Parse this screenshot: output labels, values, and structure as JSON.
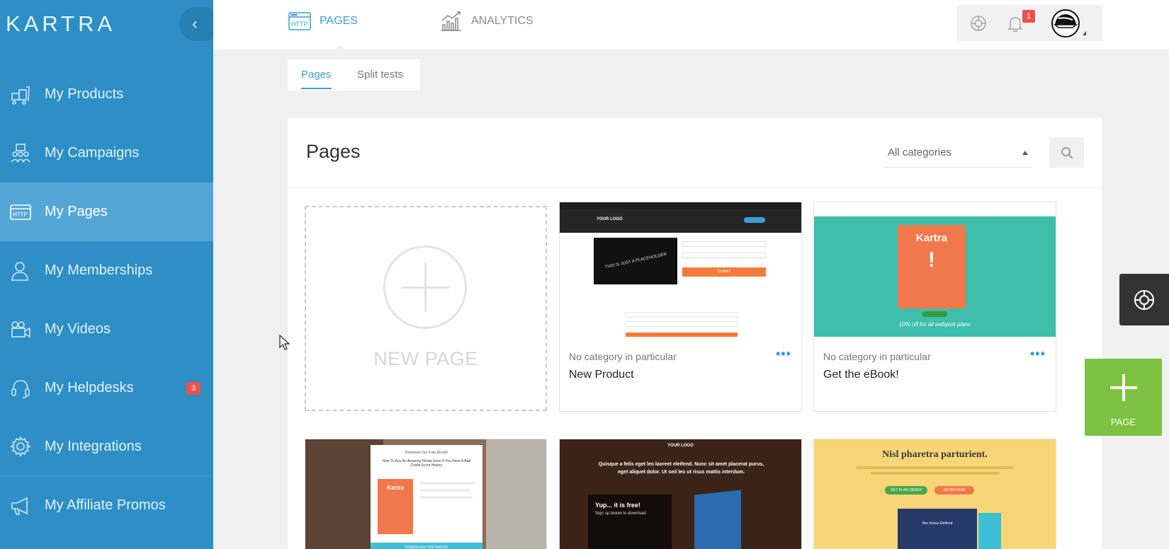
{
  "sidebar": {
    "brand": "KARTRA",
    "collapse_icon": "chevron-left-icon",
    "items": [
      {
        "label": "My Products",
        "icon": "products-icon"
      },
      {
        "label": "My Campaigns",
        "icon": "campaigns-icon"
      },
      {
        "label": "My Pages",
        "icon": "http-icon",
        "active": true
      },
      {
        "label": "My Memberships",
        "icon": "memberships-icon"
      },
      {
        "label": "My Videos",
        "icon": "video-camera-icon"
      },
      {
        "label": "My Helpdesks",
        "icon": "headset-icon",
        "badge": "3"
      },
      {
        "label": "My Integrations",
        "icon": "gear-icon"
      },
      {
        "label": "My Affiliate Promos",
        "icon": "megaphone-icon"
      }
    ]
  },
  "topbar": {
    "tabs": [
      {
        "label": "PAGES",
        "icon": "http-icon",
        "active": true
      },
      {
        "label": "ANALYTICS",
        "icon": "analytics-icon"
      }
    ],
    "notification_count": "1",
    "icons": [
      "help-icon",
      "bell-icon",
      "avatar"
    ]
  },
  "subtabs": {
    "pages": "Pages",
    "split_tests": "Split tests"
  },
  "panel": {
    "title": "Pages",
    "category_select": "All categories",
    "search_icon": "search-icon"
  },
  "new_page": {
    "label": "NEW PAGE"
  },
  "cards": [
    {
      "category": "No category in particular",
      "title": "New Product",
      "thumb": {
        "logo": "YOUR LOGO",
        "video_text": "THIS IS JUST A PLACEHOLDER",
        "button": "SUBMIT"
      }
    },
    {
      "category": "No category in particular",
      "title": "Get the eBook!",
      "thumb": {
        "book_title": "Kartra",
        "caption": "10% off for all webpick plans"
      }
    },
    {
      "thumb": {
        "heading": "Download Our Free Ebook!",
        "subheading": "How To Buy An Amazing House Even If You Have A Bad Credit Score History",
        "book_title": "Kartra",
        "button": "DOWNLOAD THE EBOOK"
      }
    },
    {
      "thumb": {
        "logo": "YOUR LOGO",
        "headline": "Quisque a felis eget leo laoreet eleifend. Nunc sit amet placerat purus, eget aliquet dolor. Ut sed leo ut risus mattis interdum.",
        "panel_title": "Yup... it is free!",
        "panel_sub": "Sign up below to download"
      }
    },
    {
      "thumb": {
        "headline": "Nisl pharetra parturient.",
        "button_a": "GET IN AN ORDER",
        "button_b": "ENTER NOW",
        "mock_title": "Nec lectus Eleifend"
      }
    }
  ],
  "floating": {
    "help_icon": "lifebuoy-icon",
    "add_page_label": "PAGE"
  },
  "colors": {
    "sidebar": "#2d8fc6",
    "sidebar_active": "#54a6d6",
    "accent": "#3c9ed6",
    "add_button": "#7cc13f",
    "badge": "#e9534f"
  }
}
